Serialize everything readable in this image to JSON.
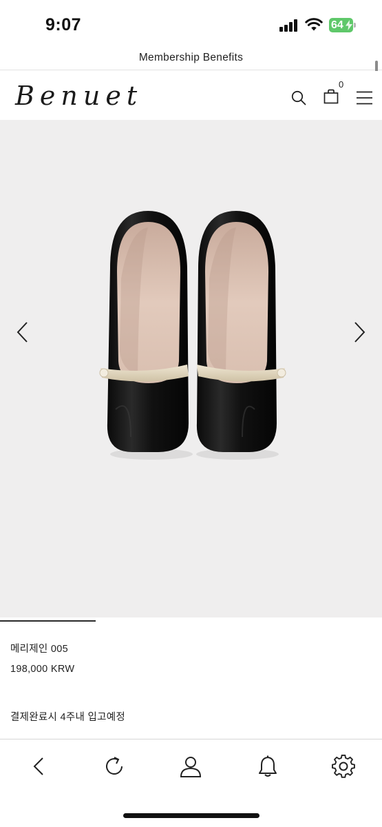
{
  "status_bar": {
    "time": "9:07",
    "battery_level": "64",
    "battery_color": "#5fc86a"
  },
  "banner": {
    "text": "Membership Benefits"
  },
  "header": {
    "logo": "Benuet",
    "cart_count": "0",
    "icons": [
      "search-icon",
      "shopping-bag-icon",
      "menu-icon"
    ]
  },
  "gallery": {
    "background": "#efeeee",
    "image_description_icon": "shoe-product-image",
    "prev_icon": "chevron-left-icon",
    "next_icon": "chevron-right-icon"
  },
  "product": {
    "name": "메리제인 005",
    "price": "198,000 KRW",
    "shipping_note": "결제완료시 4주내 입고예정"
  },
  "toolbar": {
    "icons": [
      "back-icon",
      "refresh-icon",
      "profile-icon",
      "notification-bell-icon",
      "settings-gear-icon"
    ]
  }
}
